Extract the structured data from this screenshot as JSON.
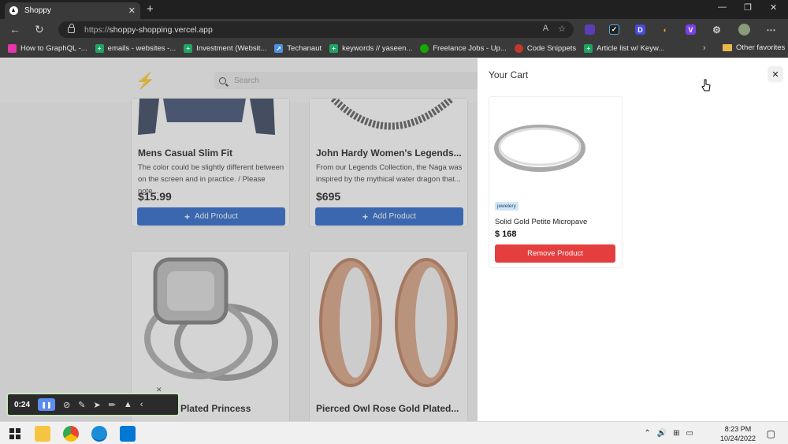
{
  "browser": {
    "tab_title": "Shoppy",
    "url_protocol": "https://",
    "url_host": "shoppy-shopping.vercel.app",
    "bookmarks": [
      {
        "label": "How to GraphQL -...",
        "icon": "graphql-icon",
        "color": "#e535ab"
      },
      {
        "label": "emails - websites -...",
        "icon": "sheets-icon",
        "color": "#1fa463"
      },
      {
        "label": "Investment (Websit...",
        "icon": "sheets-icon",
        "color": "#1fa463"
      },
      {
        "label": "Techanaut",
        "icon": "rocket-icon",
        "color": "#4a90e2"
      },
      {
        "label": "keywords // yaseen...",
        "icon": "sheets-icon",
        "color": "#1fa463"
      },
      {
        "label": "Freelance Jobs - Up...",
        "icon": "upwork-icon",
        "color": "#14a800"
      },
      {
        "label": "Code Snippets",
        "icon": "snippet-icon",
        "color": "#c0392b"
      },
      {
        "label": "Article list w/ Keyw...",
        "icon": "sheets-icon",
        "color": "#1fa463"
      }
    ],
    "other_favorites": "Other favorites"
  },
  "site": {
    "search_placeholder": "Search",
    "products": [
      {
        "name": "Mens Casual Slim Fit",
        "desc_line1": "The color could be slightly different between",
        "desc_line2": "on the screen and in practice. / Please note...",
        "price": "$15.99",
        "button": "Add Product"
      },
      {
        "name": "John Hardy Women's Legends...",
        "desc_line1": "From our Legends Collection, the Naga was",
        "desc_line2": "inspired by the mythical water dragon that...",
        "price": "$695",
        "button": "Add Product"
      },
      {
        "name": "ld Plated Princess",
        "desc_line1": "",
        "desc_line2": "",
        "price": "",
        "button": ""
      },
      {
        "name": "Pierced Owl Rose Gold Plated...",
        "desc_line1": "",
        "desc_line2": "",
        "price": "",
        "button": ""
      }
    ]
  },
  "cart": {
    "title": "Your Cart",
    "close": "✕",
    "item": {
      "category": "jewelery",
      "name": "Solid Gold Petite Micropave",
      "price": "$ 168",
      "remove_label": "Remove Product"
    }
  },
  "recorder": {
    "time": "0:24"
  },
  "taskbar": {
    "time": "8:23 PM",
    "date": "10/24/2022"
  },
  "colors": {
    "primary_button": "#1d5fc9",
    "remove_button": "#e53e3e"
  }
}
